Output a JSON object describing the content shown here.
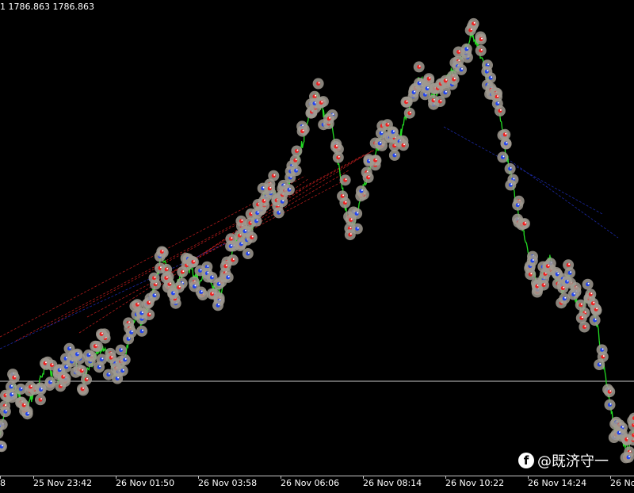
{
  "header": {
    "ohlc_text": "1 1786.863 1786.863"
  },
  "time_axis": {
    "labels": [
      "8",
      "25 Nov 23:42",
      "26 Nov 01:50",
      "26 Nov 03:58",
      "26 Nov 06:06",
      "26 Nov 08:14",
      "26 Nov 10:22",
      "26 Nov 14:24",
      "26 Nov 1"
    ]
  },
  "watermark": {
    "text": "@既济守一",
    "icon": "facebook-icon"
  },
  "colors": {
    "background": "#000000",
    "price_line": "#22dd22",
    "marker_halo": "#a09a90",
    "marker_buy": "#2244ee",
    "marker_sell": "#ee2222",
    "trend_line_red": "#cc2020",
    "trend_line_blue": "#2030c0",
    "horizontal_level": "#c8c8c8"
  },
  "chart_data": {
    "type": "line",
    "title": "",
    "series": [
      {
        "values": [
          0.0,
          0.08,
          0.12,
          0.1,
          0.06,
          0.1,
          0.12,
          0.18,
          0.15,
          0.13,
          0.16,
          0.2,
          0.17,
          0.14,
          0.17,
          0.2,
          0.22,
          0.18,
          0.15,
          0.18,
          0.25,
          0.3,
          0.28,
          0.32,
          0.38,
          0.44,
          0.4,
          0.36,
          0.4,
          0.42,
          0.4,
          0.38,
          0.42,
          0.37,
          0.35,
          0.4,
          0.46,
          0.5,
          0.48,
          0.52,
          0.56,
          0.6,
          0.62,
          0.58,
          0.6,
          0.64,
          0.68,
          0.74,
          0.82,
          0.84,
          0.8,
          0.78,
          0.7,
          0.6,
          0.52,
          0.54,
          0.6,
          0.66,
          0.7,
          0.74,
          0.76,
          0.72,
          0.75,
          0.8,
          0.86,
          0.88,
          0.86,
          0.84,
          0.86,
          0.88,
          0.9,
          0.92,
          0.96,
          1.0,
          0.96,
          0.9,
          0.86,
          0.82,
          0.72,
          0.64,
          0.56,
          0.5,
          0.42,
          0.38,
          0.4,
          0.44,
          0.38,
          0.36,
          0.4,
          0.34,
          0.3,
          0.36,
          0.3,
          0.2,
          0.1,
          0.02,
          0.0,
          -0.04,
          0.02
        ]
      }
    ],
    "xlabel": "",
    "ylabel": ""
  }
}
